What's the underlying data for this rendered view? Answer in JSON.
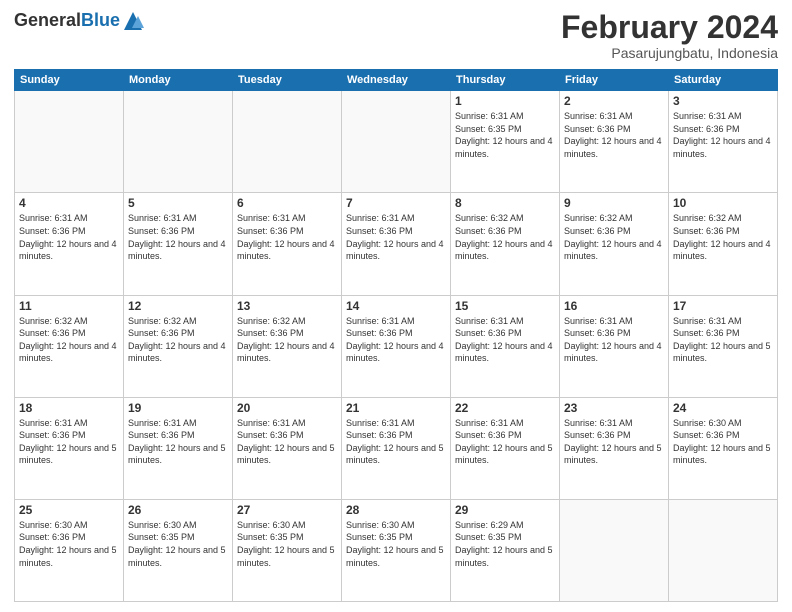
{
  "logo": {
    "general": "General",
    "blue": "Blue"
  },
  "header": {
    "month_year": "February 2024",
    "location": "Pasarujungbatu, Indonesia"
  },
  "days_of_week": [
    "Sunday",
    "Monday",
    "Tuesday",
    "Wednesday",
    "Thursday",
    "Friday",
    "Saturday"
  ],
  "weeks": [
    [
      {
        "day": "",
        "info": ""
      },
      {
        "day": "",
        "info": ""
      },
      {
        "day": "",
        "info": ""
      },
      {
        "day": "",
        "info": ""
      },
      {
        "day": "1",
        "info": "Sunrise: 6:31 AM\nSunset: 6:35 PM\nDaylight: 12 hours and 4 minutes."
      },
      {
        "day": "2",
        "info": "Sunrise: 6:31 AM\nSunset: 6:36 PM\nDaylight: 12 hours and 4 minutes."
      },
      {
        "day": "3",
        "info": "Sunrise: 6:31 AM\nSunset: 6:36 PM\nDaylight: 12 hours and 4 minutes."
      }
    ],
    [
      {
        "day": "4",
        "info": "Sunrise: 6:31 AM\nSunset: 6:36 PM\nDaylight: 12 hours and 4 minutes."
      },
      {
        "day": "5",
        "info": "Sunrise: 6:31 AM\nSunset: 6:36 PM\nDaylight: 12 hours and 4 minutes."
      },
      {
        "day": "6",
        "info": "Sunrise: 6:31 AM\nSunset: 6:36 PM\nDaylight: 12 hours and 4 minutes."
      },
      {
        "day": "7",
        "info": "Sunrise: 6:31 AM\nSunset: 6:36 PM\nDaylight: 12 hours and 4 minutes."
      },
      {
        "day": "8",
        "info": "Sunrise: 6:32 AM\nSunset: 6:36 PM\nDaylight: 12 hours and 4 minutes."
      },
      {
        "day": "9",
        "info": "Sunrise: 6:32 AM\nSunset: 6:36 PM\nDaylight: 12 hours and 4 minutes."
      },
      {
        "day": "10",
        "info": "Sunrise: 6:32 AM\nSunset: 6:36 PM\nDaylight: 12 hours and 4 minutes."
      }
    ],
    [
      {
        "day": "11",
        "info": "Sunrise: 6:32 AM\nSunset: 6:36 PM\nDaylight: 12 hours and 4 minutes."
      },
      {
        "day": "12",
        "info": "Sunrise: 6:32 AM\nSunset: 6:36 PM\nDaylight: 12 hours and 4 minutes."
      },
      {
        "day": "13",
        "info": "Sunrise: 6:32 AM\nSunset: 6:36 PM\nDaylight: 12 hours and 4 minutes."
      },
      {
        "day": "14",
        "info": "Sunrise: 6:31 AM\nSunset: 6:36 PM\nDaylight: 12 hours and 4 minutes."
      },
      {
        "day": "15",
        "info": "Sunrise: 6:31 AM\nSunset: 6:36 PM\nDaylight: 12 hours and 4 minutes."
      },
      {
        "day": "16",
        "info": "Sunrise: 6:31 AM\nSunset: 6:36 PM\nDaylight: 12 hours and 4 minutes."
      },
      {
        "day": "17",
        "info": "Sunrise: 6:31 AM\nSunset: 6:36 PM\nDaylight: 12 hours and 5 minutes."
      }
    ],
    [
      {
        "day": "18",
        "info": "Sunrise: 6:31 AM\nSunset: 6:36 PM\nDaylight: 12 hours and 5 minutes."
      },
      {
        "day": "19",
        "info": "Sunrise: 6:31 AM\nSunset: 6:36 PM\nDaylight: 12 hours and 5 minutes."
      },
      {
        "day": "20",
        "info": "Sunrise: 6:31 AM\nSunset: 6:36 PM\nDaylight: 12 hours and 5 minutes."
      },
      {
        "day": "21",
        "info": "Sunrise: 6:31 AM\nSunset: 6:36 PM\nDaylight: 12 hours and 5 minutes."
      },
      {
        "day": "22",
        "info": "Sunrise: 6:31 AM\nSunset: 6:36 PM\nDaylight: 12 hours and 5 minutes."
      },
      {
        "day": "23",
        "info": "Sunrise: 6:31 AM\nSunset: 6:36 PM\nDaylight: 12 hours and 5 minutes."
      },
      {
        "day": "24",
        "info": "Sunrise: 6:30 AM\nSunset: 6:36 PM\nDaylight: 12 hours and 5 minutes."
      }
    ],
    [
      {
        "day": "25",
        "info": "Sunrise: 6:30 AM\nSunset: 6:36 PM\nDaylight: 12 hours and 5 minutes."
      },
      {
        "day": "26",
        "info": "Sunrise: 6:30 AM\nSunset: 6:35 PM\nDaylight: 12 hours and 5 minutes."
      },
      {
        "day": "27",
        "info": "Sunrise: 6:30 AM\nSunset: 6:35 PM\nDaylight: 12 hours and 5 minutes."
      },
      {
        "day": "28",
        "info": "Sunrise: 6:30 AM\nSunset: 6:35 PM\nDaylight: 12 hours and 5 minutes."
      },
      {
        "day": "29",
        "info": "Sunrise: 6:29 AM\nSunset: 6:35 PM\nDaylight: 12 hours and 5 minutes."
      },
      {
        "day": "",
        "info": ""
      },
      {
        "day": "",
        "info": ""
      }
    ]
  ]
}
